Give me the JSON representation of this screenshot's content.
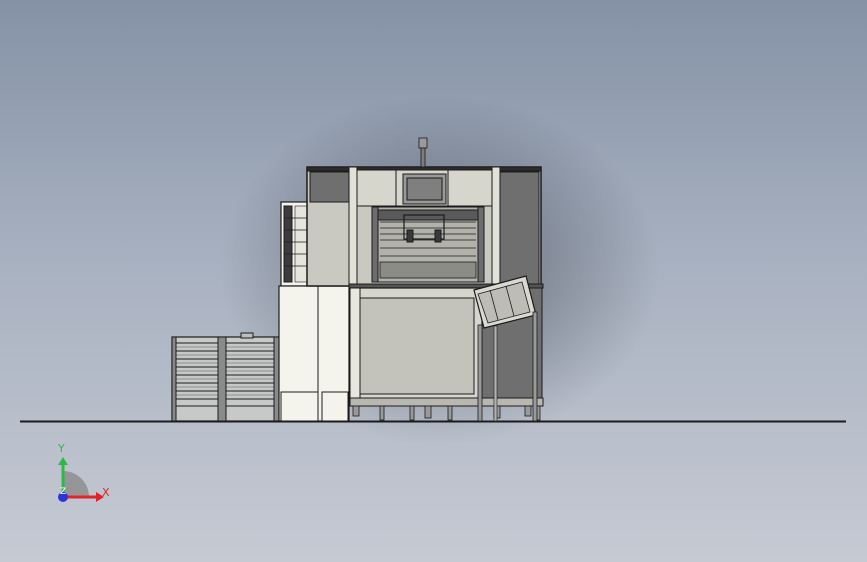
{
  "viewport": {
    "colors": {
      "background_top": "#8592a6",
      "background_bottom": "#c6cad3",
      "model_outline": "#1b1b1b",
      "panel_light": "#f5f4ec",
      "panel_mid": "#c9c9c1",
      "panel_dark": "#6f6f6f"
    }
  },
  "model": {
    "name_icon": "machine-assembly-icon"
  },
  "triad": {
    "x_label": "X",
    "y_label": "Y",
    "z_label": "Z",
    "x_color": "#e0242a",
    "y_color": "#2fb84a",
    "z_color": "#2a35d8"
  }
}
